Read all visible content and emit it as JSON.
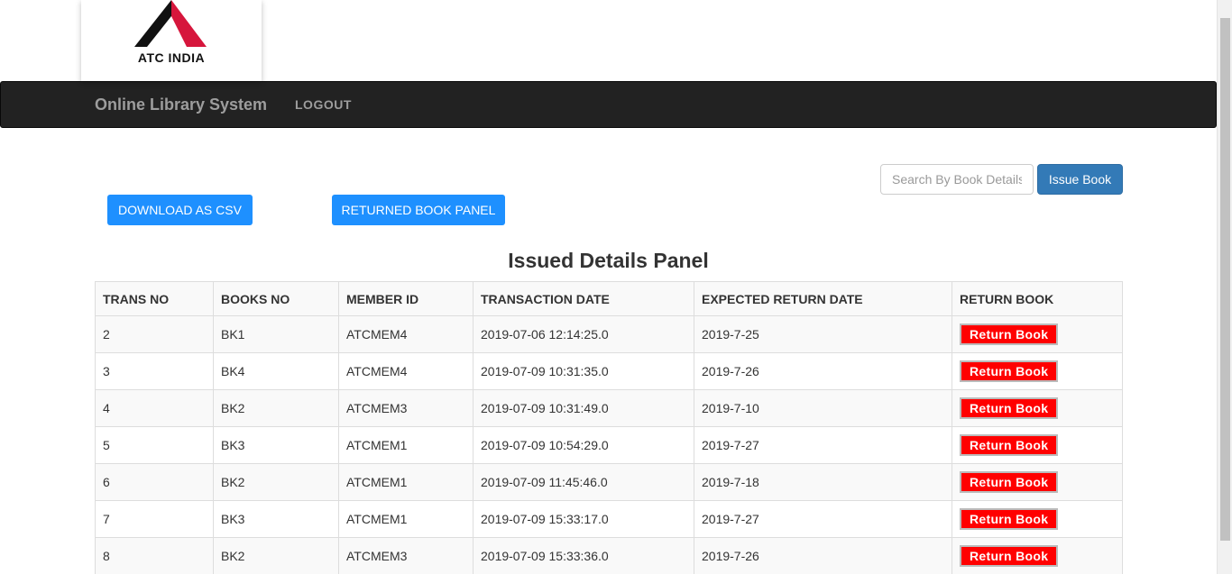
{
  "logo": {
    "text": "ATC INDIA",
    "icon": "atc-logo-icon",
    "colors": {
      "dark": "#111111",
      "red": "#d6163c"
    }
  },
  "navbar": {
    "brand": "Online Library System",
    "logout": "LOGOUT"
  },
  "search": {
    "placeholder": "Search By Book Details"
  },
  "buttons": {
    "issue_book": "Issue Book",
    "download_csv": "DOWNLOAD AS CSV",
    "returned_panel": "RETURNED BOOK PANEL"
  },
  "panel_title": "Issued Details Panel",
  "table": {
    "headers": [
      "TRANS NO",
      "BOOKS NO",
      "MEMBER ID",
      "TRANSACTION DATE",
      "EXPECTED RETURN DATE",
      "RETURN BOOK"
    ],
    "return_label": "Return Book",
    "rows": [
      [
        "2",
        "BK1",
        "ATCMEM4",
        "2019-07-06 12:14:25.0",
        "2019-7-25"
      ],
      [
        "3",
        "BK4",
        "ATCMEM4",
        "2019-07-09 10:31:35.0",
        "2019-7-26"
      ],
      [
        "4",
        "BK2",
        "ATCMEM3",
        "2019-07-09 10:31:49.0",
        "2019-7-10"
      ],
      [
        "5",
        "BK3",
        "ATCMEM1",
        "2019-07-09 10:54:29.0",
        "2019-7-27"
      ],
      [
        "6",
        "BK2",
        "ATCMEM1",
        "2019-07-09 11:45:46.0",
        "2019-7-18"
      ],
      [
        "7",
        "BK3",
        "ATCMEM1",
        "2019-07-09 15:33:17.0",
        "2019-7-27"
      ],
      [
        "8",
        "BK2",
        "ATCMEM3",
        "2019-07-09 15:33:36.0",
        "2019-7-26"
      ]
    ]
  },
  "colors": {
    "navbar": "#222222",
    "primary": "#337ab7",
    "accent": "#1e90ff",
    "danger": "#ff0000"
  }
}
